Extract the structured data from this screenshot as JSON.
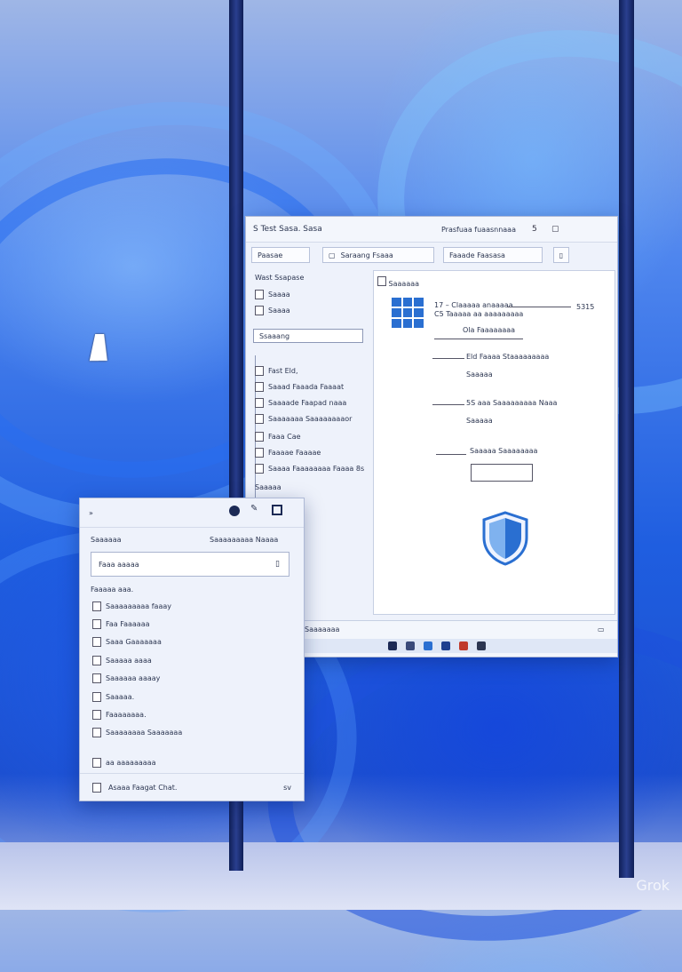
{
  "main_window": {
    "title": "S Test Sasa. Sasa",
    "title_right": "Prasfuaa fuaasnnaaa",
    "controls": [
      "5",
      "▢"
    ],
    "toolbar": {
      "field1": "Paasae",
      "field2": "Saraang Fsaaa",
      "field3": "Faaade Faasasa"
    },
    "sidebar": {
      "items_top": [
        "Wast Ssapase",
        "Saaaa",
        "Saaaa"
      ],
      "selected": "Ssaaang",
      "items": [
        "Fast Eld,",
        "Saaad Faaada Faaaat",
        "Saaaade Faapad naaa",
        "Saaaaaaa Saaaaaaaaor",
        "Faaa Cae",
        "Faaaae Faaaae",
        "Saaaa Faaaaaaaa Faaaa 8s",
        "Saaaaa"
      ]
    },
    "panel": {
      "header": "Saaaaaa",
      "lines": [
        "17 – Claaaaa anaaaaa",
        "C5 Taaaaa aa aaaaaaaaa",
        "Ola Faaaaaaaa",
        "Eld Faaaa Staaaaaaaaa",
        "Saaaaa",
        "5S aaa Saaaaaaaaa Naaa",
        "Saaaaa",
        "Saaaaa Saaaaaaaa"
      ],
      "corner_value": "5315"
    },
    "status_label": "Saaaaaaa"
  },
  "small_window": {
    "icons": [
      "circle-icon",
      "pen-icon",
      "box-icon"
    ],
    "heading_left": "Saaaaaa",
    "heading_right": "Saaaaaaaaa Naaaa",
    "input_value": "Faaa aaaaa",
    "list_title": "Faaaaa aaa.",
    "items": [
      "Saaaaaaaaa faaay",
      "Faa Faaaaaa",
      "Saaa Gaaaaaaa",
      "Saaaaa aaaa",
      "Saaaaaa aaaay",
      "Saaaaa.",
      "Faaaaaaaa.",
      "Saaaaaaaa Saaaaaaa"
    ],
    "bottom_item": "aa aaaaaaaaa",
    "footer_label": "Asaaa Faagat Chat.",
    "footer_right": "sv"
  },
  "watermark": "Grok",
  "colors": {
    "accent": "#2a6fd1",
    "pole": "#1b2c6e",
    "desktop": "#1f5ee0"
  }
}
